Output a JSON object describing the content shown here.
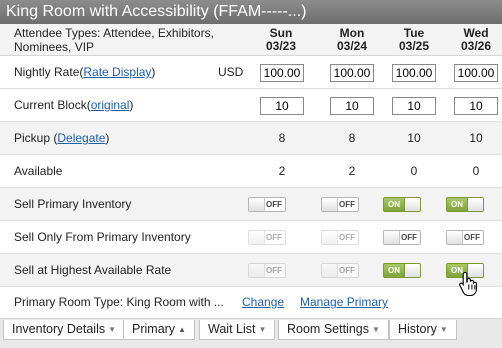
{
  "window": {
    "title": "King Room with Accessibility  (FFAM-----...)"
  },
  "header": {
    "attendee_types": "Attendee Types: Attendee, Exhibitors, Nominees, VIP",
    "days": [
      {
        "dow": "Sun",
        "date": "03/23"
      },
      {
        "dow": "Mon",
        "date": "03/24"
      },
      {
        "dow": "Tue",
        "date": "03/25"
      },
      {
        "dow": "Wed",
        "date": "03/26"
      }
    ]
  },
  "nightly_rate": {
    "label": "Nightly Rate",
    "link_text": "Rate Display",
    "currency": "USD",
    "values": [
      "100.00",
      "100.00",
      "100.00",
      "100.00"
    ]
  },
  "current_block": {
    "label": "Current Block",
    "link_text": "original",
    "values": [
      "10",
      "10",
      "10",
      "10"
    ]
  },
  "pickup": {
    "label": "Pickup (",
    "link_text": "Delegate",
    "label_end": ")",
    "values": [
      "8",
      "8",
      "10",
      "10"
    ]
  },
  "available": {
    "label": "Available",
    "values": [
      "2",
      "2",
      "0",
      "0"
    ]
  },
  "toggle_text": {
    "on": "ON",
    "off": "OFF"
  },
  "sell_primary_inventory": {
    "label": "Sell Primary Inventory",
    "states": [
      "OFF",
      "OFF",
      "ON",
      "ON"
    ],
    "disabled": [
      false,
      false,
      false,
      false
    ]
  },
  "sell_only_from_primary": {
    "label": "Sell Only From Primary Inventory",
    "states": [
      "OFF",
      "OFF",
      "OFF",
      "OFF"
    ],
    "disabled": [
      true,
      true,
      false,
      false
    ]
  },
  "sell_at_highest_rate": {
    "label": "Sell at Highest Available Rate",
    "states": [
      "OFF",
      "OFF",
      "ON",
      "ON"
    ],
    "disabled": [
      true,
      true,
      false,
      false
    ]
  },
  "primary_room": {
    "label": "Primary Room Type: King Room with ...",
    "change_link": "Change",
    "manage_link": "Manage Primary"
  },
  "tabs": [
    {
      "label": "Inventory Details",
      "caret": "▼"
    },
    {
      "label": "Primary",
      "caret": "▲"
    },
    {
      "label": "Wait List",
      "caret": "▼"
    },
    {
      "label": "Room Settings",
      "caret": "▼"
    },
    {
      "label": "History",
      "caret": "▼"
    }
  ],
  "colors": {
    "title_bar": "#7c7c7c",
    "toggle_on": "#8fb04a",
    "link": "#1f5ea8"
  }
}
